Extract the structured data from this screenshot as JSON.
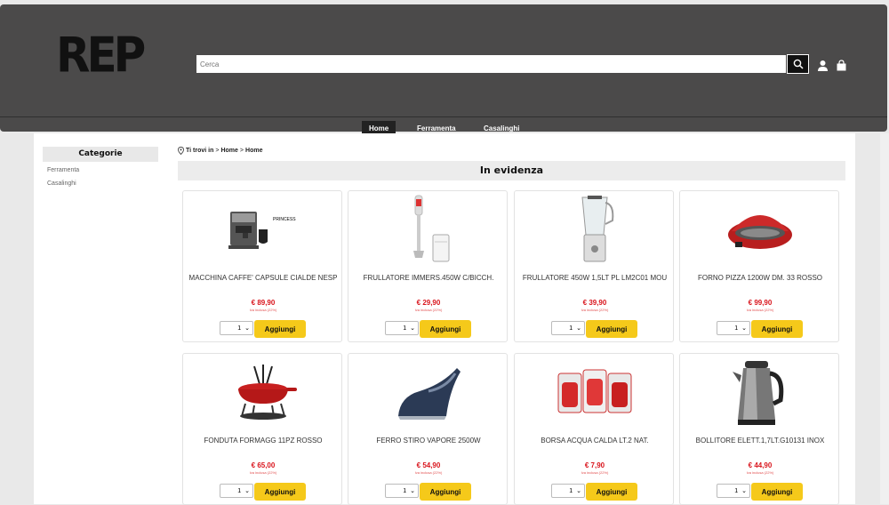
{
  "header": {
    "logo": "REP",
    "search_placeholder": "Cerca"
  },
  "nav": [
    "Home",
    "Ferramenta",
    "Casalinghi"
  ],
  "sidebar": {
    "title": "Categorie",
    "items": [
      "Ferramenta",
      "Casalinghi"
    ]
  },
  "breadcrumb": {
    "prefix": "Ti trovi in",
    "sep": ">",
    "items": [
      "Home",
      "Home"
    ]
  },
  "section_title": "In evidenza",
  "products": [
    {
      "name": "MACCHINA CAFFE' CAPSULE CIALDE NESP",
      "price": "€ 89,90",
      "vat": "Iva inclusa (22%)",
      "qty": "1",
      "add": "Aggiungi",
      "icon": "coffee-machine-icon"
    },
    {
      "name": "FRULLATORE IMMERS.450W C/BICCH.",
      "price": "€ 29,90",
      "vat": "Iva inclusa (22%)",
      "qty": "1",
      "add": "Aggiungi",
      "icon": "hand-blender-icon"
    },
    {
      "name": "FRULLATORE 450W 1,5LT PL LM2C01 MOU",
      "price": "€ 39,90",
      "vat": "Iva inclusa (22%)",
      "qty": "1",
      "add": "Aggiungi",
      "icon": "blender-icon"
    },
    {
      "name": "FORNO PIZZA 1200W DM. 33 ROSSO",
      "price": "€ 99,90",
      "vat": "Iva inclusa (22%)",
      "qty": "1",
      "add": "Aggiungi",
      "icon": "pizza-oven-icon"
    },
    {
      "name": "FONDUTA FORMAGG 11PZ ROSSO",
      "price": "€ 65,00",
      "vat": "Iva inclusa (22%)",
      "qty": "1",
      "add": "Aggiungi",
      "icon": "fondue-set-icon"
    },
    {
      "name": "FERRO STIRO VAPORE 2500W",
      "price": "€ 54,90",
      "vat": "Iva inclusa (22%)",
      "qty": "1",
      "add": "Aggiungi",
      "icon": "steam-iron-icon"
    },
    {
      "name": "BORSA ACQUA CALDA LT.2 NAT.",
      "price": "€ 7,90",
      "vat": "Iva inclusa (22%)",
      "qty": "1",
      "add": "Aggiungi",
      "icon": "hot-water-bottle-icon"
    },
    {
      "name": "BOLLITORE ELETT.1,7LT.G10131 INOX",
      "price": "€ 44,90",
      "vat": "Iva inclusa (22%)",
      "qty": "1",
      "add": "Aggiungi",
      "icon": "kettle-icon"
    }
  ],
  "colors": {
    "header_bg": "#4b4a4a",
    "price": "#d9141c",
    "add_button": "#f5c91a"
  }
}
